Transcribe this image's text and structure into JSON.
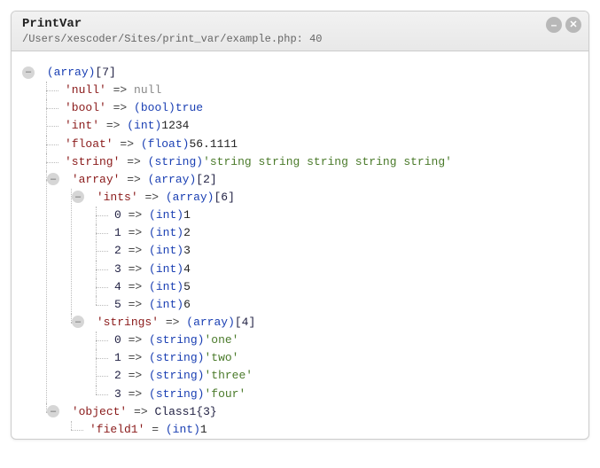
{
  "panel": {
    "title": "PrintVar",
    "file": "/Users/xescoder/Sites/print_var/example.php",
    "line": "40"
  },
  "root": {
    "type": "(array)",
    "count": "[7]"
  },
  "items": {
    "null": {
      "key": "'null'",
      "arrow": "=>",
      "val": "null"
    },
    "bool": {
      "key": "'bool'",
      "arrow": "=>",
      "type": "(bool)",
      "val": "true"
    },
    "int": {
      "key": "'int'",
      "arrow": "=>",
      "type": "(int)",
      "val": "1234"
    },
    "float": {
      "key": "'float'",
      "arrow": "=>",
      "type": "(float)",
      "val": "56.1111"
    },
    "string": {
      "key": "'string'",
      "arrow": "=>",
      "type": "(string)",
      "val": "'string string string string string'"
    },
    "array": {
      "key": "'array'",
      "arrow": "=>",
      "type": "(array)",
      "count": "[2]"
    },
    "ints": {
      "key": "'ints'",
      "arrow": "=>",
      "type": "(array)",
      "count": "[6]",
      "rows": [
        {
          "idx": "0",
          "arrow": "=>",
          "type": "(int)",
          "val": "1"
        },
        {
          "idx": "1",
          "arrow": "=>",
          "type": "(int)",
          "val": "2"
        },
        {
          "idx": "2",
          "arrow": "=>",
          "type": "(int)",
          "val": "3"
        },
        {
          "idx": "3",
          "arrow": "=>",
          "type": "(int)",
          "val": "4"
        },
        {
          "idx": "4",
          "arrow": "=>",
          "type": "(int)",
          "val": "5"
        },
        {
          "idx": "5",
          "arrow": "=>",
          "type": "(int)",
          "val": "6"
        }
      ]
    },
    "strings": {
      "key": "'strings'",
      "arrow": "=>",
      "type": "(array)",
      "count": "[4]",
      "rows": [
        {
          "idx": "0",
          "arrow": "=>",
          "type": "(string)",
          "val": "'one'"
        },
        {
          "idx": "1",
          "arrow": "=>",
          "type": "(string)",
          "val": "'two'"
        },
        {
          "idx": "2",
          "arrow": "=>",
          "type": "(string)",
          "val": "'three'"
        },
        {
          "idx": "3",
          "arrow": "=>",
          "type": "(string)",
          "val": "'four'"
        }
      ]
    },
    "object": {
      "key": "'object'",
      "arrow": "=>",
      "cls": "Class1{3}",
      "rows": [
        {
          "key": "'field1'",
          "eq": "=",
          "type": "(int)",
          "val": "1"
        }
      ]
    }
  },
  "glyph": {
    "minus": "–"
  }
}
